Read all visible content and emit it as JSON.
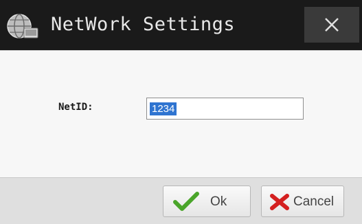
{
  "window": {
    "title": "NetWork Settings",
    "app_icon": "globe-network-icon",
    "close_icon": "close-icon"
  },
  "form": {
    "netid_label": "NetID:",
    "netid_value": "1234"
  },
  "buttons": {
    "ok_label": "Ok",
    "ok_icon": "checkmark-icon",
    "cancel_label": "Cancel",
    "cancel_icon": "x-icon"
  },
  "colors": {
    "titlebar": "#1a1a1a",
    "selection": "#2f74d0",
    "ok_check": "#4aa52a",
    "cancel_x": "#d42020"
  }
}
